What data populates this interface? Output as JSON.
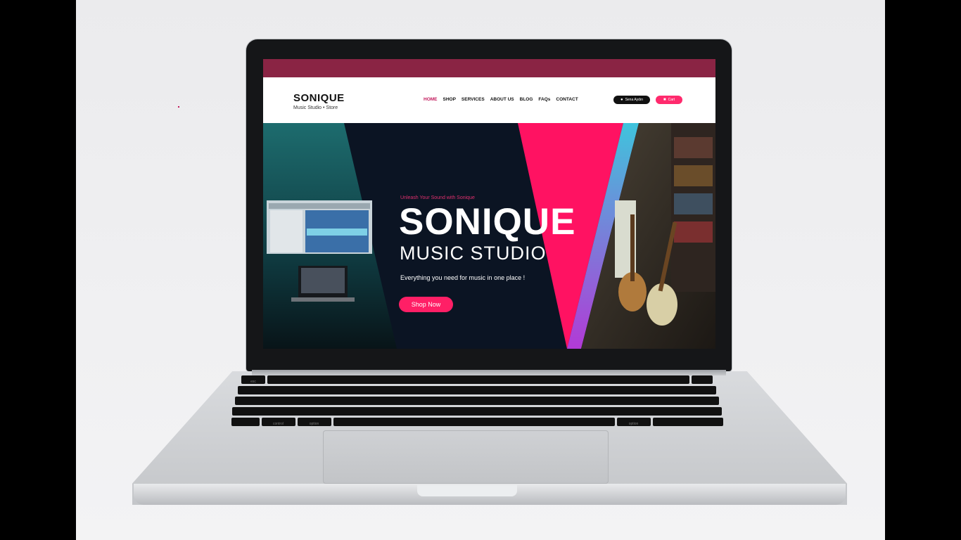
{
  "site": {
    "brand_title": "SONIQUE",
    "brand_subtitle": "Music Studio • Store",
    "nav": [
      "HOME",
      "SHOP",
      "SERVICES",
      "ABOUT US",
      "BLOG",
      "FAQs",
      "CONTACT"
    ],
    "active_nav": "HOME",
    "user_label": "Sena Aydın",
    "cart_label": "Cart",
    "hero": {
      "eyebrow": "Unleash Your Sound with Sonique",
      "title": "SONIQUE",
      "subtitle": "MUSIC STUDIO",
      "text": "Everything you need for music in one place !",
      "button": "Shop Now"
    }
  },
  "colors": {
    "accent": "#ff1f66",
    "topbar": "#8a2444",
    "hero_bg": "#0b1423"
  },
  "keyboard": {
    "labels": {
      "control": "control",
      "option_left": "option",
      "option_right": "option",
      "esc": "esc"
    }
  }
}
